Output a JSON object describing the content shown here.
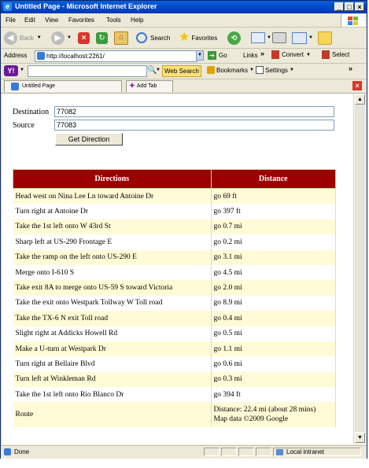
{
  "window": {
    "title": "Untitled Page - Microsoft Internet Explorer",
    "minimize": "_",
    "maximize": "□",
    "close": "×"
  },
  "menu": [
    "File",
    "Edit",
    "View",
    "Favorites",
    "Tools",
    "Help"
  ],
  "toolbar": {
    "back": "Back",
    "search": "Search",
    "favorites": "Favorites"
  },
  "address": {
    "label": "Address",
    "url": "http://localhost:2261/",
    "go": "Go",
    "links": "Links",
    "convert": "Convert",
    "select": "Select"
  },
  "yahoo": {
    "logo": "Y!",
    "web_search": "Web Search",
    "bookmarks": "Bookmarks",
    "settings": "Settings"
  },
  "tabs": {
    "active": "Untitled Page",
    "add": "Add Tab"
  },
  "form": {
    "destination_label": "Destination",
    "destination_value": "77082",
    "source_label": "Source",
    "source_value": "77083",
    "button": "Get Direction"
  },
  "table": {
    "headers": [
      "Directions",
      "Distance"
    ],
    "rows": [
      [
        "Head west on Nina Lee Ln toward Antoine Dr",
        "go 69 ft"
      ],
      [
        "Turn right at Antoine Dr",
        "go 397 ft"
      ],
      [
        "Take the 1st left onto W 43rd St",
        "go 0.7 mi"
      ],
      [
        "Sharp left at US-290 Frontage E",
        "go 0.2 mi"
      ],
      [
        "Take the ramp on the left onto US-290 E",
        "go 3.1 mi"
      ],
      [
        "Merge onto I-610 S",
        "go 4.5 mi"
      ],
      [
        "Take exit 8A to merge onto US-59 S toward Victoria",
        "go 2.0 mi"
      ],
      [
        "Take the exit onto Westpark Tollway W Toll road",
        "go 8.9 mi"
      ],
      [
        "Take the TX-6 N exit Toll road",
        "go 0.4 mi"
      ],
      [
        "Slight right at Addicks Howell Rd",
        "go 0.5 mi"
      ],
      [
        "Make a U-turn at Westpark Dr",
        "go 1.1 mi"
      ],
      [
        "Turn right at Bellaire Blvd",
        "go 0.6 mi"
      ],
      [
        "Turn left at Winkleman Rd",
        "go 0.3 mi"
      ],
      [
        "Take the 1st left onto Rio Blanco Dr",
        "go 394 ft"
      ]
    ],
    "route_label": "Route",
    "route_distance": "Distance: 22.4 mi (about 28 mins)",
    "route_mapdata": "Map data ©2009 Google"
  },
  "status": {
    "text": "Done",
    "zone": "Local intranet"
  }
}
